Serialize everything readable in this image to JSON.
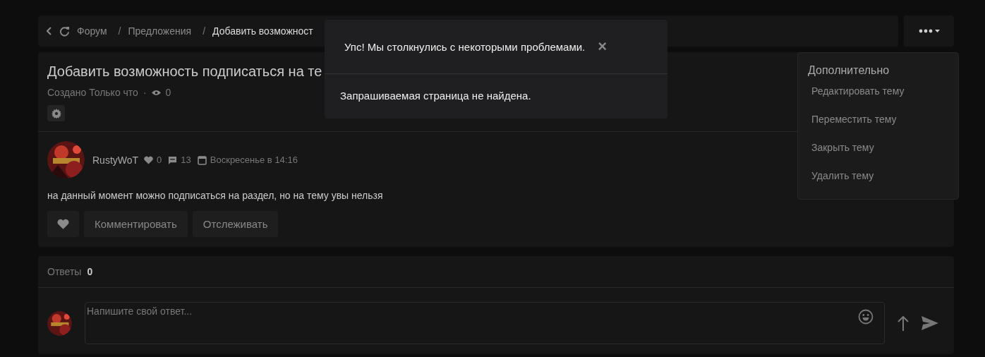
{
  "breadcrumbs": [
    {
      "label": "Форум",
      "current": false
    },
    {
      "label": "Предложения",
      "current": false
    },
    {
      "label": "Добавить возможност",
      "current": true
    }
  ],
  "breadcrumb_separator": "/",
  "topic": {
    "title": "Добавить возможность подписаться на те",
    "created": "Создано Только что",
    "meta_separator": "·",
    "views": "0"
  },
  "post": {
    "author": "RustyWoT",
    "likes": "0",
    "comments": "13",
    "date": "Воскресенье в 14:16",
    "body": "на данный момент можно подписаться на раздел, но на тему увы нельзя",
    "actions": [
      "Комментировать",
      "Отслеживать"
    ]
  },
  "replies": {
    "label": "Ответы",
    "count": "0",
    "placeholder": "Напишите свой ответ..."
  },
  "dialog": {
    "title": "Упс! Мы столкнулись с некоторыми проблемами.",
    "close": "×",
    "message": "Запрашиваемая страница не найдена."
  },
  "menu": {
    "title": "Дополнительно",
    "items": [
      "Редактировать тему",
      "Переместить тему",
      "Закрыть тему",
      "Удалить тему"
    ]
  }
}
